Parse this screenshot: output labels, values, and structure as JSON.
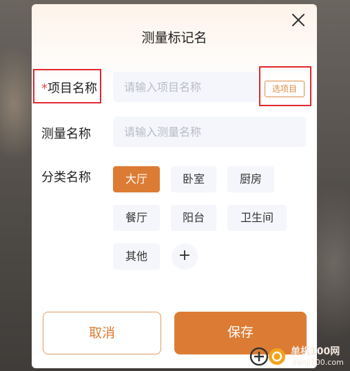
{
  "dialog": {
    "title": "测量标记名",
    "close_icon": "close-icon"
  },
  "project_field": {
    "required_mark": "*",
    "label": "项目名称",
    "placeholder": "请输入项目名称",
    "pick_button": "选项目"
  },
  "measure_field": {
    "label": "测量名称",
    "placeholder": "请输入测量名称"
  },
  "category": {
    "label": "分类名称",
    "options": [
      "大厅",
      "卧室",
      "厨房",
      "餐厅",
      "阳台",
      "卫生间",
      "其他"
    ],
    "selected": "大厅",
    "add_label": "+"
  },
  "actions": {
    "cancel": "取消",
    "save": "保存"
  },
  "watermark": {
    "name": "单机100网",
    "domain": "danji100.com"
  },
  "colors": {
    "accent": "#dc7c34",
    "highlight_box": "#e3262e",
    "required": "#e5484d"
  }
}
